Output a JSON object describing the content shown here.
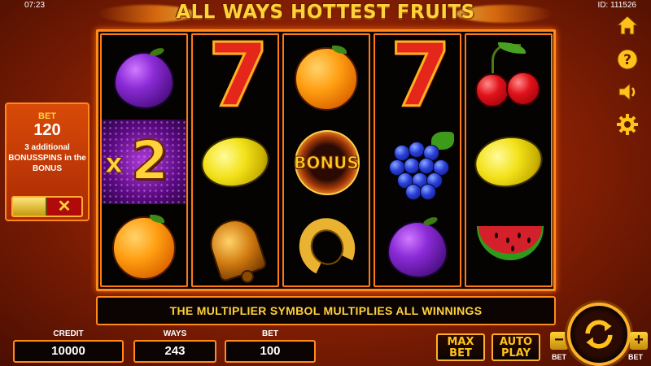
{
  "status": {
    "time": "07:23",
    "id_label": "ID: 111526"
  },
  "game": {
    "title": "ALL WAYS HOTTEST FRUITS"
  },
  "reels": [
    [
      "plum",
      "multiplier",
      "orange"
    ],
    [
      "seven",
      "lemon",
      "bell"
    ],
    [
      "orange",
      "bonus",
      "horseshoe"
    ],
    [
      "seven",
      "grapes",
      "plum"
    ],
    [
      "cherries",
      "lemon",
      "watermelon"
    ]
  ],
  "multiplier": {
    "x": "x",
    "value": "2"
  },
  "bonus_symbol": {
    "label": "BONUS"
  },
  "bet_panel": {
    "label": "BET",
    "value": "120",
    "message": "3 additional BONUSSPINS in the BONUS",
    "toggle_off": "✕"
  },
  "message_bar": "THE MULTIPLIER SYMBOL MULTIPLIES ALL WINNINGS",
  "counters": {
    "credit": {
      "label": "CREDIT",
      "value": "10000"
    },
    "ways": {
      "label": "WAYS",
      "value": "243"
    },
    "bet": {
      "label": "BET",
      "value": "100"
    }
  },
  "buttons": {
    "max_bet": "MAX BET",
    "auto_play": "AUTO PLAY",
    "bet_minus": "−",
    "bet_plus": "+",
    "bet_minus_label": "BET",
    "bet_plus_label": "BET"
  },
  "side_icons": [
    "home-icon",
    "help-icon",
    "sound-icon",
    "settings-icon"
  ],
  "colors": {
    "accent": "#ffd23a",
    "frame": "#ff8a1a",
    "background": "#8e2204"
  }
}
